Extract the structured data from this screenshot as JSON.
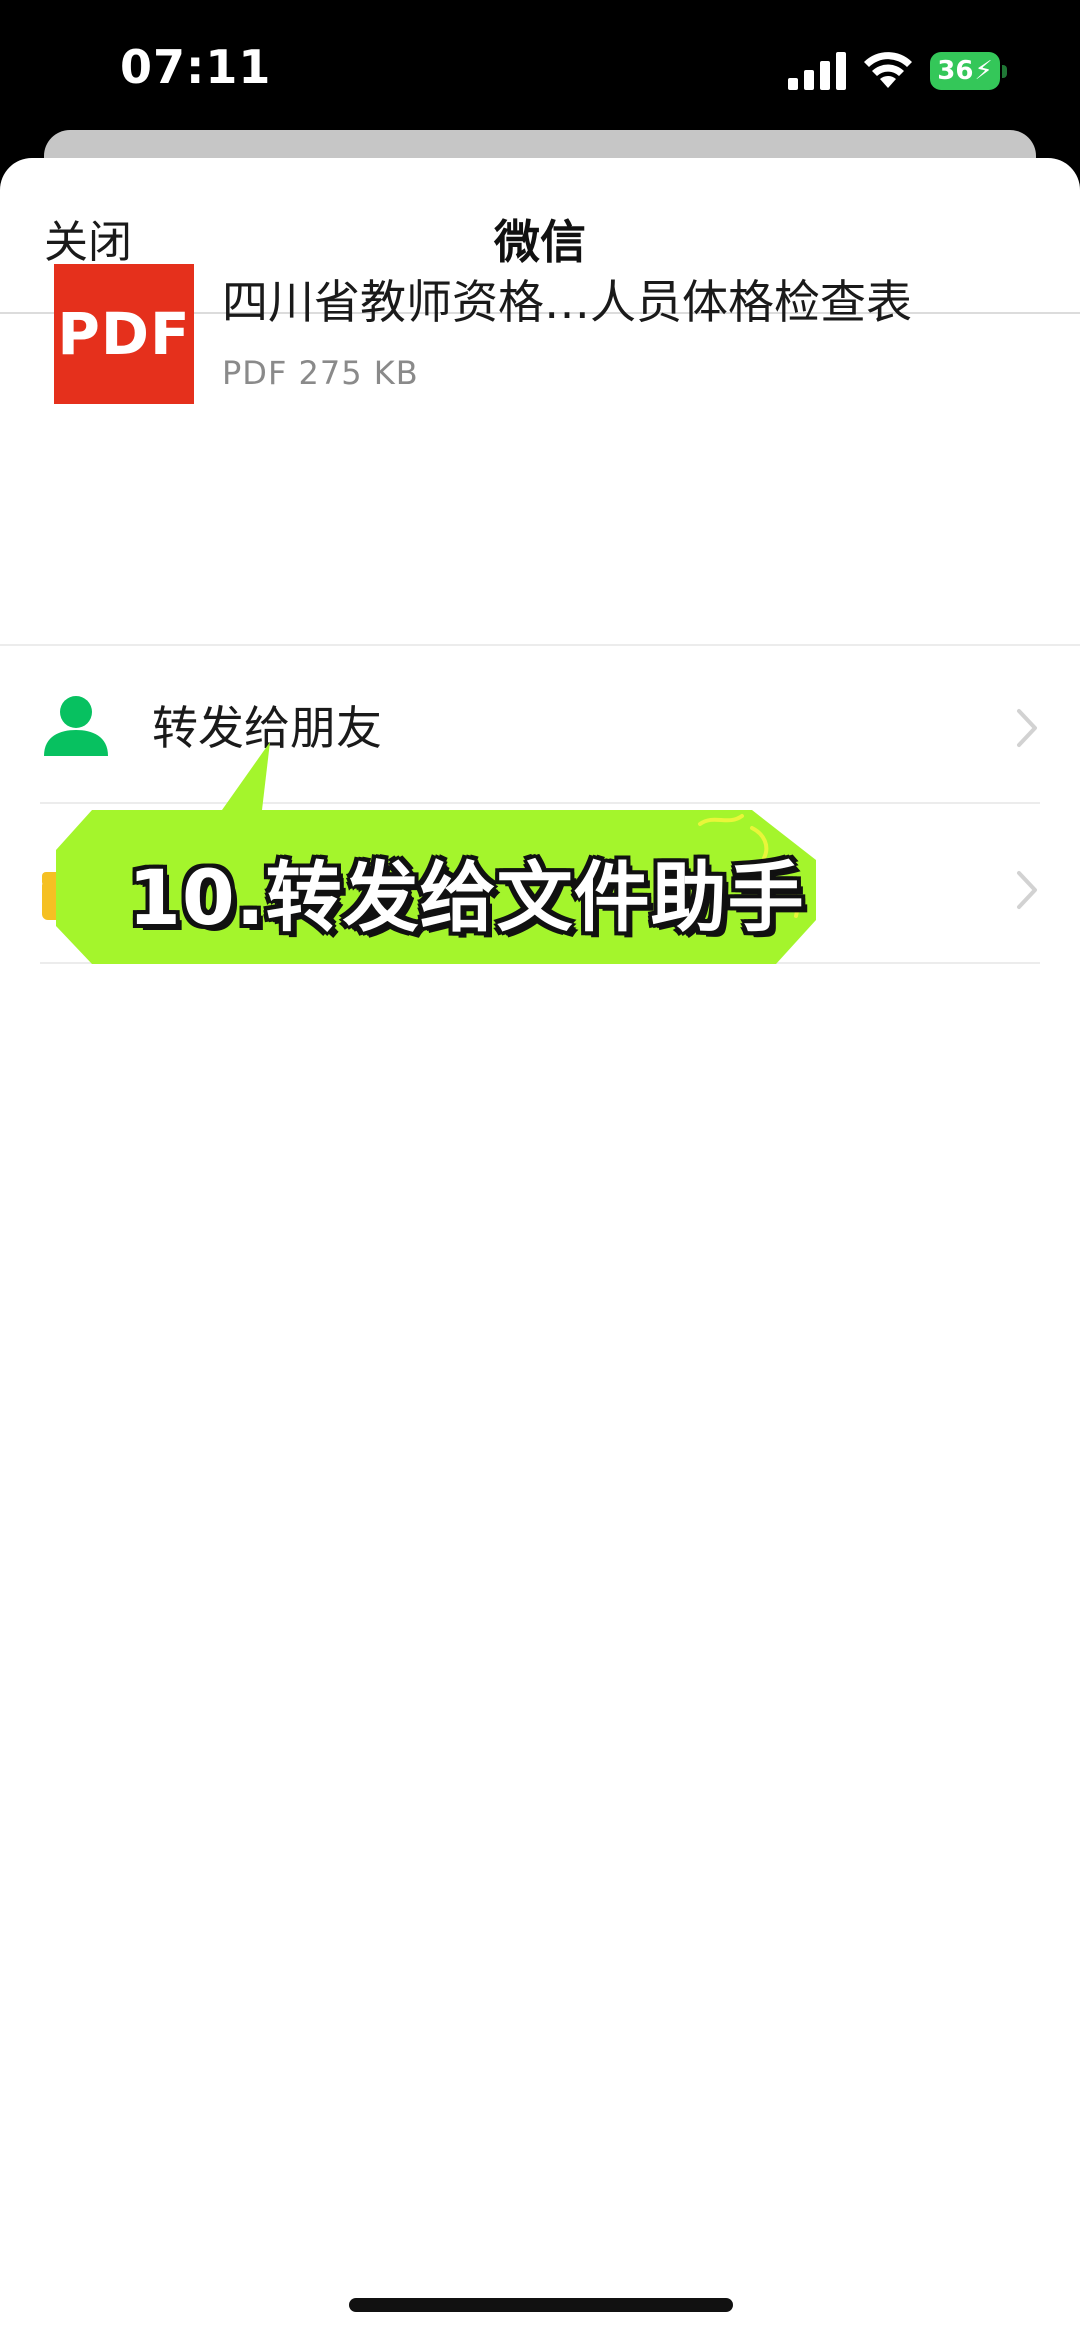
{
  "status_bar": {
    "time": "07:11",
    "battery_level": "36",
    "icons": [
      "cellular-signal-icon",
      "wifi-icon",
      "battery-charging-icon"
    ]
  },
  "nav": {
    "close_label": "关闭",
    "title": "微信"
  },
  "file": {
    "icon_label": "PDF",
    "name": "四川省教师资格…人员体格检查表",
    "meta": "PDF 275 KB"
  },
  "actions": [
    {
      "label": "转发给朋友",
      "icon": "person-icon"
    },
    {
      "label": "",
      "icon": "file-transfer-icon"
    }
  ],
  "overlay": {
    "text": "10.转发给文件助手",
    "color": "#a4f52c"
  },
  "colors": {
    "pdf_red": "#e5301c",
    "wechat_green": "#07c160",
    "battery_green": "#34c759"
  }
}
